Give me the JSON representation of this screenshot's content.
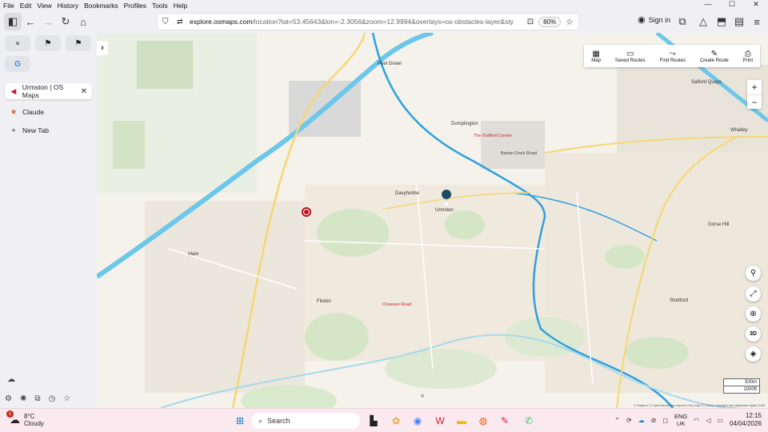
{
  "menu": [
    "File",
    "Edit",
    "View",
    "History",
    "Bookmarks",
    "Profiles",
    "Tools",
    "Help"
  ],
  "toolbar": {
    "url_host": "explore.osmaps.com",
    "url_rest": "/location?lat=53.45643&lon=-2.3056&zoom=12.9994&overlays=os-obstacles-layer&sty",
    "zoom": "80%",
    "sign_in": "Sign in"
  },
  "sidebar": {
    "tabs": [
      {
        "label": "Urmston | OS Maps",
        "icon": "os-maps-icon"
      },
      {
        "label": "Claude",
        "icon": "claude-icon"
      },
      {
        "label": "New Tab",
        "icon": "plus-icon"
      }
    ]
  },
  "map": {
    "toolbar": [
      "Map",
      "Saved Routes",
      "Find Routes",
      "Create Route",
      "Print"
    ],
    "scale": [
      "500m",
      "1000ft"
    ],
    "attribution": "© Mapbox  © OpenStreetMap  Improve this map  © Crown copyright and database rights 2026",
    "labels": {
      "flixton": "Flixton",
      "urmston": "Urmston",
      "davyhulme": "Davyhulme",
      "irlam": "Irlam",
      "stretford": "Stretford",
      "dumplington": "Dumplington",
      "gorse_hill": "Gorse Hill",
      "whalley": "Whalley",
      "peel_green": "Peel Green",
      "trafford_centre": "The Trafford Centre",
      "barton_dock": "Barton Dock Road",
      "salford_quays": "Salford Quays",
      "chassen_road": "Chassen Road"
    }
  },
  "taskbar": {
    "temp": "8°C",
    "weather": "Cloudy",
    "search": "Search",
    "lang_top": "ENG",
    "lang_bottom": "UK",
    "time": "12:15",
    "date": "04/04/2026",
    "badge": "1"
  }
}
